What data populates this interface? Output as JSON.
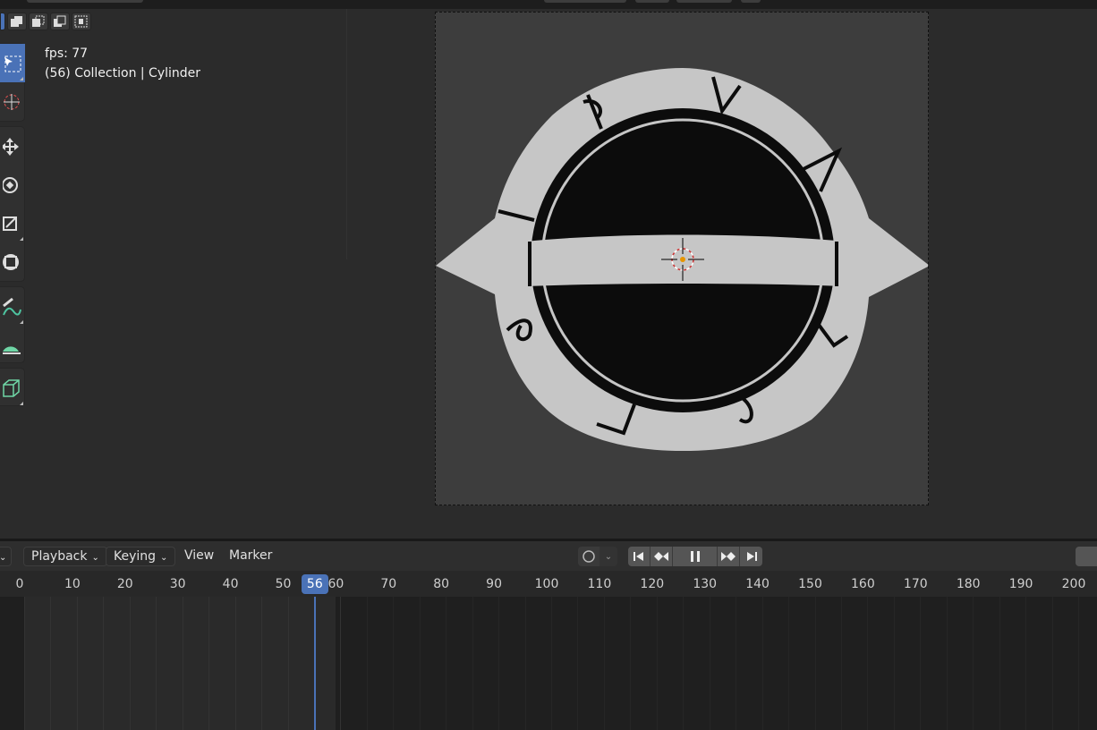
{
  "viewport": {
    "fps_text": "fps: 77",
    "object_info": "(56) Collection | Cylinder"
  },
  "tools": [
    "select-box",
    "cursor",
    "move",
    "rotate",
    "scale",
    "transform",
    "annotate",
    "measure",
    "add-cube"
  ],
  "timeline": {
    "left_dropdown_chevron": "⌄",
    "menus": {
      "playback": "Playback",
      "keying": "Keying",
      "view": "View",
      "marker": "Marker"
    },
    "current_frame": "56",
    "frame_ticks": [
      "0",
      "10",
      "20",
      "30",
      "40",
      "50",
      "60",
      "70",
      "80",
      "90",
      "100",
      "110",
      "120",
      "130",
      "140",
      "150",
      "160",
      "170",
      "180",
      "190",
      "200"
    ]
  },
  "colors": {
    "accent": "#4a72b7",
    "background": "#2b2b2b",
    "camera_frame": "#3d3d3d"
  }
}
